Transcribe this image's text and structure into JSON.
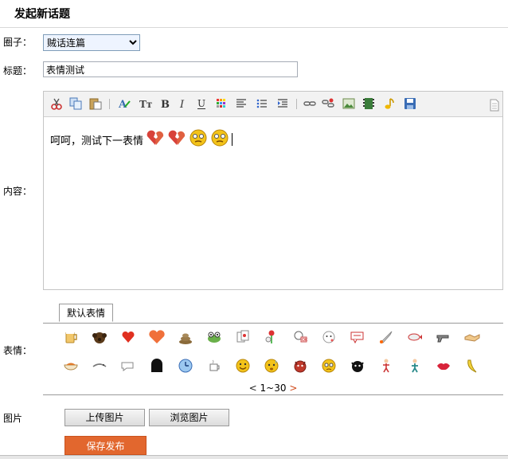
{
  "header": {
    "title": "发起新话题"
  },
  "form": {
    "circle_label": "圈子：",
    "circle_value": "贼话连篇",
    "title_label": "标题：",
    "title_value": "表情测试",
    "content_label": "内容：",
    "content_text": "呵呵，测试下一表情",
    "emoticons_label": "表情：",
    "image_label": "图片"
  },
  "toolbar": {
    "icons": [
      "cut-icon",
      "copy-icon",
      "paste-icon",
      "text-style-icon",
      "font-size-icon",
      "bold-icon",
      "italic-icon",
      "underline-icon",
      "color-grid-icon",
      "align-icon",
      "bullet-list-icon",
      "indent-icon",
      "link-icon",
      "unlink-icon",
      "image-icon",
      "video-icon",
      "music-icon",
      "save-icon",
      "document-icon"
    ]
  },
  "emoticon_panel": {
    "tab_label": "默认表情",
    "pager_range": "1~30",
    "prev": "<",
    "next": ">"
  },
  "buttons": {
    "upload": "上传图片",
    "browse": "浏览图片",
    "save": "保存发布"
  },
  "colors": {
    "accent": "#e2672e",
    "link": "#d04a1a"
  }
}
